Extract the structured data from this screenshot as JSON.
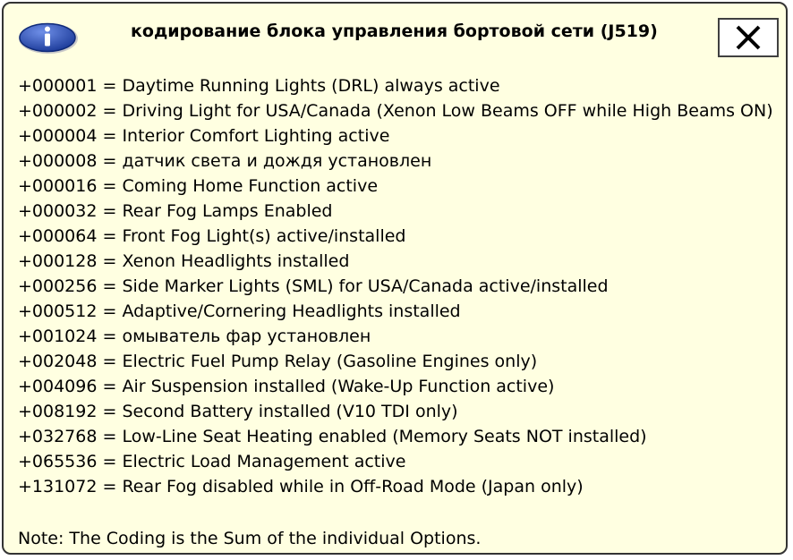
{
  "dialog": {
    "title": "кодирование блока управления бортовой сети (J519)",
    "icon": "info-icon",
    "close_icon": "close-icon",
    "colors": {
      "background": "#ffffe1",
      "icon_blue": "#2b50b8"
    }
  },
  "options": [
    "+000001 = Daytime Running Lights (DRL) always active",
    "+000002 = Driving Light for USA/Canada (Xenon Low Beams OFF while High Beams ON)",
    "+000004 = Interior Comfort Lighting active",
    "+000008 = датчик света и дождя установлен",
    "+000016 = Coming Home Function active",
    "+000032 = Rear Fog Lamps Enabled",
    "+000064 = Front Fog Light(s) active/installed",
    "+000128 = Xenon Headlights installed",
    "+000256 = Side Marker Lights (SML) for USA/Canada active/installed",
    "+000512 = Adaptive/Cornering Headlights installed",
    "+001024 = омыватель фар установлен",
    "+002048 = Electric Fuel Pump Relay (Gasoline Engines only)",
    "+004096 = Air Suspension installed (Wake-Up Function active)",
    "+008192 = Second Battery installed (V10 TDI only)",
    "+032768 = Low-Line Seat Heating enabled (Memory Seats NOT installed)",
    "+065536 = Electric Load Management active",
    "+131072 = Rear Fog disabled while in Off-Road Mode (Japan only)"
  ],
  "note": "Note: The Coding is the Sum of the individual Options."
}
